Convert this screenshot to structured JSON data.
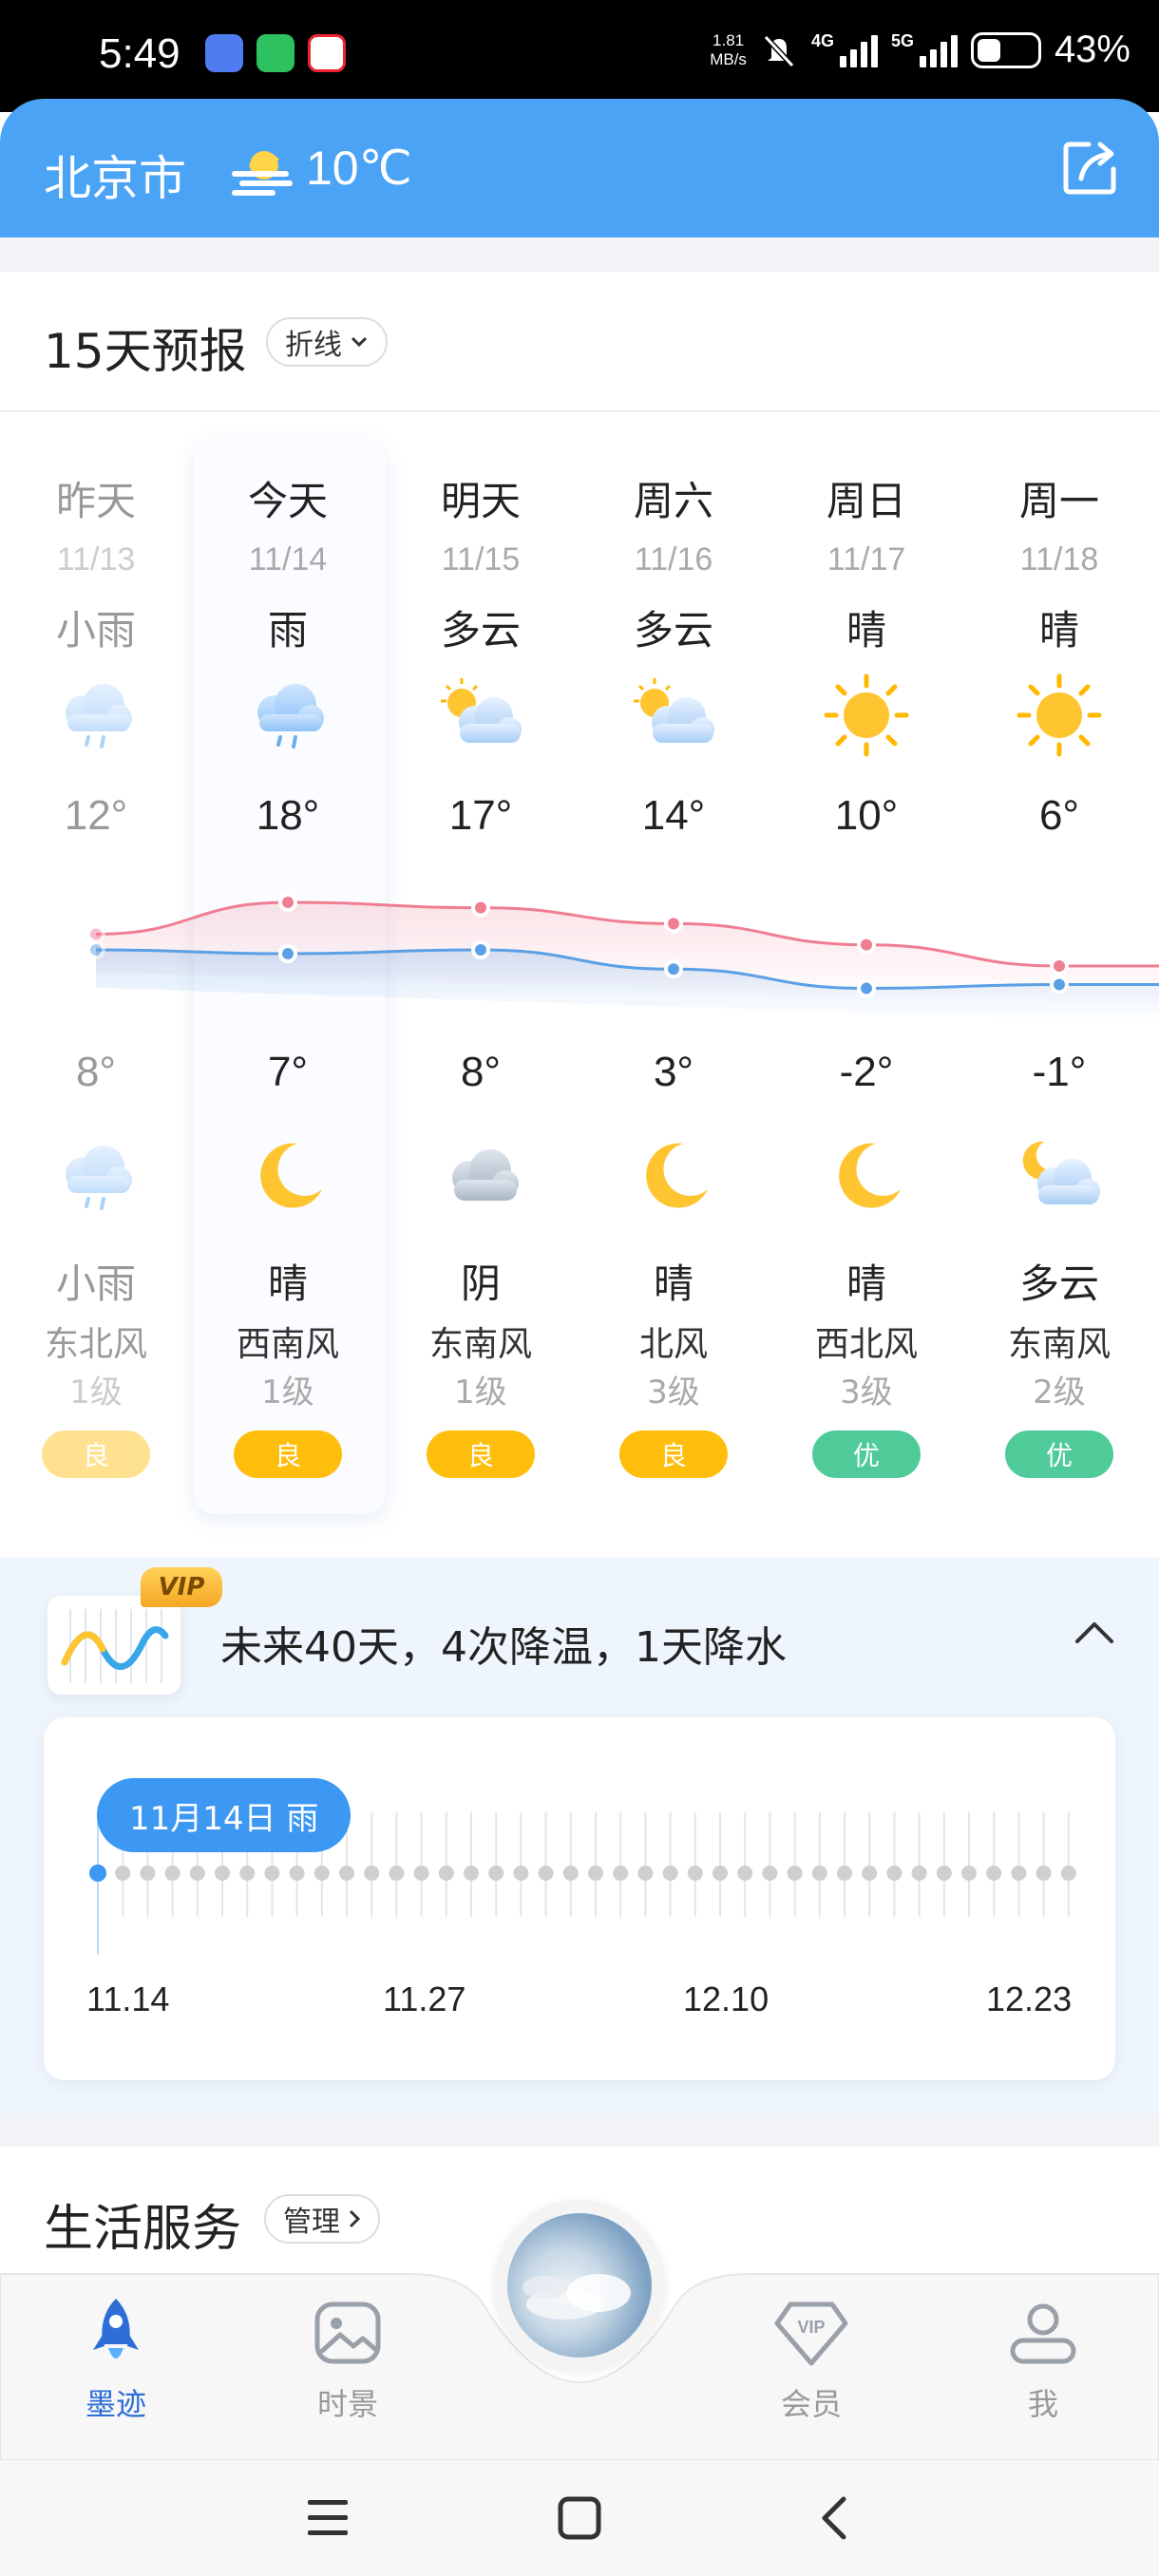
{
  "status_bar": {
    "time": "5:49",
    "net_speed": "1.81",
    "net_unit": "MB/s",
    "net1": "4G",
    "net2": "5G",
    "battery": "43%"
  },
  "header": {
    "city": "北京市",
    "temp": "10℃",
    "weather_icon": "fog-sun-icon",
    "share_icon": "share-icon"
  },
  "forecast": {
    "title": "15天预报",
    "mode_label": "折线",
    "days": [
      {
        "day": "昨天",
        "date": "11/13",
        "day_weather": "小雨",
        "day_icon": "rain-cloud",
        "high": "12°",
        "low": "8°",
        "night_icon": "rain-cloud",
        "night_weather": "小雨",
        "wind": "东北风",
        "level": "1级",
        "aqi": "良",
        "past": true
      },
      {
        "day": "今天",
        "date": "11/14",
        "day_weather": "雨",
        "day_icon": "rain-cloud",
        "high": "18°",
        "low": "7°",
        "night_icon": "moon",
        "night_weather": "晴",
        "wind": "西南风",
        "level": "1级",
        "aqi": "良"
      },
      {
        "day": "明天",
        "date": "11/15",
        "day_weather": "多云",
        "day_icon": "sun-cloud",
        "high": "17°",
        "low": "8°",
        "night_icon": "overcast",
        "night_weather": "阴",
        "wind": "东南风",
        "level": "1级",
        "aqi": "良"
      },
      {
        "day": "周六",
        "date": "11/16",
        "day_weather": "多云",
        "day_icon": "sun-cloud",
        "high": "14°",
        "low": "3°",
        "night_icon": "moon",
        "night_weather": "晴",
        "wind": "北风",
        "level": "3级",
        "aqi": "良"
      },
      {
        "day": "周日",
        "date": "11/17",
        "day_weather": "晴",
        "day_icon": "sun",
        "high": "10°",
        "low": "-2°",
        "night_icon": "moon",
        "night_weather": "晴",
        "wind": "西北风",
        "level": "3级",
        "aqi": "优"
      },
      {
        "day": "周一",
        "date": "11/18",
        "day_weather": "晴",
        "day_icon": "sun",
        "high": "6°",
        "low": "-1°",
        "night_icon": "moon-cloud",
        "night_weather": "多云",
        "wind": "东南风",
        "level": "2级",
        "aqi": "优"
      }
    ],
    "high_values": [
      12,
      18,
      17,
      14,
      10,
      6
    ],
    "low_values": [
      8,
      7,
      8,
      3,
      -2,
      -1
    ],
    "colors": {
      "high": "#ef7e93",
      "low": "#5aa0e6",
      "aqi_good": "#ffbe0b",
      "aqi_excellent": "#4ecb98"
    }
  },
  "forty_day": {
    "vip_badge": "VIP",
    "summary": "未来40天，4次降温，1天降水",
    "bubble": "11月14日 雨",
    "dates": [
      "11.14",
      "11.27",
      "12.10",
      "12.23"
    ]
  },
  "life": {
    "title": "生活服务",
    "manage": "管理"
  },
  "nav": {
    "items": [
      {
        "label": "墨迹",
        "icon": "rocket-icon",
        "active": true
      },
      {
        "label": "时景",
        "icon": "photo-icon"
      },
      {
        "label": "会员",
        "icon": "vip-gem-icon"
      },
      {
        "label": "我",
        "icon": "user-icon"
      }
    ]
  }
}
